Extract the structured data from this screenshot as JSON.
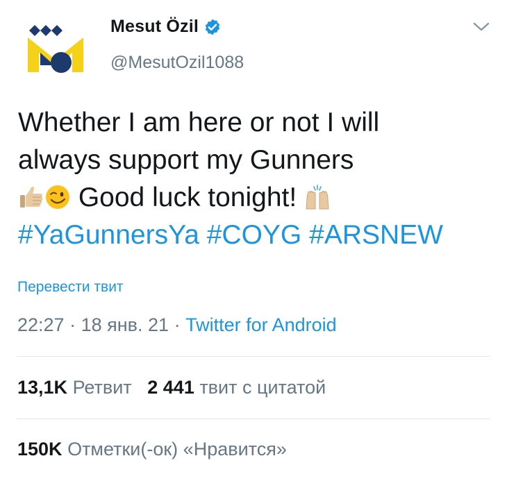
{
  "user": {
    "display_name": "Mesut Özil",
    "handle": "@MesutOzil1088",
    "verified": true,
    "avatar_icon": "m10-logo-icon"
  },
  "tweet": {
    "line1": "Whether I am here or not I will",
    "line2": "always support my Gunners",
    "line3_text": "Good luck tonight!",
    "emojis": [
      "thumbs-up-icon",
      "winking-face-icon",
      "raising-hands-icon"
    ],
    "hashtags": [
      "#YaGunnersYa",
      "#COYG",
      "#ARSNEW"
    ]
  },
  "translate_label": "Перевести твит",
  "meta": {
    "time": "22:27",
    "separator": "·",
    "date": "18 янв. 21",
    "source": "Twitter for Android"
  },
  "stats": {
    "retweets_count": "13,1K",
    "retweets_label": "Ретвит",
    "quotes_count": "2 441",
    "quotes_label": "твит с цитатой",
    "likes_count": "150K",
    "likes_label": "Отметки(-ок) «Нравится»"
  },
  "colors": {
    "accent": "#1b95e0",
    "secondary_text": "#657786",
    "primary_text": "#14171a",
    "divider": "#e1e8ed",
    "avatar_yellow": "#f5d21a",
    "avatar_navy": "#1d3a6e"
  }
}
